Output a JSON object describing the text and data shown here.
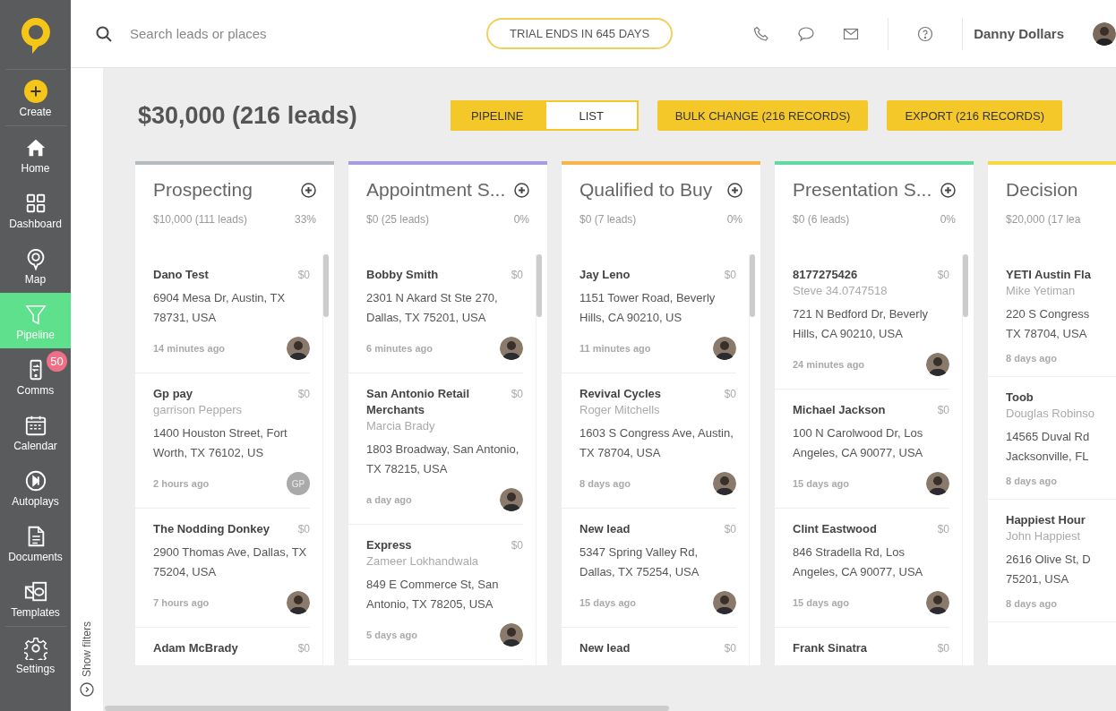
{
  "sidebar": {
    "items": [
      {
        "kind": "create",
        "label": "Create",
        "selected": false
      },
      {
        "kind": "home",
        "label": "Home",
        "selected": false
      },
      {
        "kind": "dashboard",
        "label": "Dashboard",
        "selected": false
      },
      {
        "kind": "map",
        "label": "Map",
        "selected": false
      },
      {
        "kind": "pipeline",
        "label": "Pipeline",
        "selected": true
      },
      {
        "kind": "comms",
        "label": "Comms",
        "selected": false,
        "badge": "50"
      },
      {
        "kind": "calendar",
        "label": "Calendar",
        "selected": false
      },
      {
        "kind": "autoplays",
        "label": "Autoplays",
        "selected": false
      },
      {
        "kind": "documents",
        "label": "Documents",
        "selected": false
      },
      {
        "kind": "templates",
        "label": "Templates",
        "selected": false
      },
      {
        "kind": "settings",
        "label": "Settings",
        "selected": false
      }
    ]
  },
  "search": {
    "placeholder": "Search leads or places"
  },
  "trial_banner": "TRIAL ENDS IN 645 DAYS",
  "user": {
    "name": "Danny Dollars"
  },
  "filters_toggle": "Show filters",
  "summary": "$30,000 (216 leads)",
  "view_toggle": [
    {
      "label": "PIPELINE",
      "selected": true
    },
    {
      "label": "LIST",
      "selected": false
    }
  ],
  "actions": [
    "BULK CHANGE (216 RECORDS)",
    "EXPORT (216 RECORDS)"
  ],
  "columns": [
    {
      "title": "Prospecting",
      "color": "#b4bcc0",
      "total": "$10,000 (111 leads)",
      "percent": "33%",
      "cards": [
        {
          "name": "Dano Test",
          "amount": "$0",
          "address": "6904 Mesa Dr, Austin, TX 78731, USA",
          "time": "14 minutes ago",
          "avatar": {
            "kind": "photo"
          }
        },
        {
          "name": "Gp pay",
          "amount": "$0",
          "contact": "garrison Peppers",
          "address": "1400 Houston Street, Fort Worth, TX 76102, US",
          "time": "2 hours ago",
          "avatar": {
            "kind": "initials",
            "text": "GP"
          }
        },
        {
          "name": "The Nodding Donkey",
          "amount": "$0",
          "address": "2900 Thomas Ave, Dallas, TX 75204, USA",
          "time": "7 hours ago",
          "avatar": {
            "kind": "photo"
          }
        },
        {
          "name": "Adam McBrady",
          "amount": "$0"
        }
      ]
    },
    {
      "title": "Appointment S...",
      "color": "#a99be0",
      "total": "$0 (25 leads)",
      "percent": "0%",
      "cards": [
        {
          "name": "Bobby Smith",
          "amount": "$0",
          "address": "2301 N Akard St Ste 270, Dallas, TX 75201, USA",
          "time": "6 minutes ago",
          "avatar": {
            "kind": "photo"
          }
        },
        {
          "name": "San Antonio Retail Merchants",
          "amount": "$0",
          "contact": "Marcia Brady",
          "address": "1803 Broadway, San Antonio, TX 78215, USA",
          "time": "a day ago",
          "avatar": {
            "kind": "photo"
          }
        },
        {
          "name": "Express",
          "amount": "$0",
          "contact": "Zameer Lokhandwala",
          "address": "849 E Commerce St, San Antonio, TX 78205, USA",
          "time": "5 days ago",
          "avatar": {
            "kind": "photo"
          }
        }
      ]
    },
    {
      "title": "Qualified to Buy",
      "color": "#f7b54a",
      "total": "$0 (7 leads)",
      "percent": "0%",
      "cards": [
        {
          "name": "Jay Leno",
          "amount": "$0",
          "address": "1151 Tower Road, Beverly Hills, CA 90210, US",
          "time": "11 minutes ago",
          "avatar": {
            "kind": "photo"
          }
        },
        {
          "name": "Revival Cycles",
          "amount": "$0",
          "contact": "Roger Mitchells",
          "address": "1603 S Congress Ave, Austin, TX 78704, USA",
          "time": "8 days ago",
          "avatar": {
            "kind": "photo"
          }
        },
        {
          "name": "New lead",
          "amount": "$0",
          "address": "5347 Spring Valley Rd, Dallas, TX 75254, USA",
          "time": "15 days ago",
          "avatar": {
            "kind": "photo"
          }
        },
        {
          "name": "New lead",
          "amount": "$0"
        }
      ]
    },
    {
      "title": "Presentation S...",
      "color": "#5fd9a5",
      "total": "$0 (6 leads)",
      "percent": "0%",
      "cards": [
        {
          "name": "8177275426",
          "amount": "$0",
          "contact": "Steve 34.0747518",
          "address": "721 N Bedford Dr, Beverly Hills, CA 90210, USA",
          "time": "24 minutes ago",
          "avatar": {
            "kind": "photo"
          }
        },
        {
          "name": "Michael Jackson",
          "amount": "$0",
          "address": "100 N Carolwood Dr, Los Angeles, CA 90077, USA",
          "time": "15 days ago",
          "avatar": {
            "kind": "photo"
          }
        },
        {
          "name": "Clint Eastwood",
          "amount": "$0",
          "address": "846 Stradella Rd, Los Angeles, CA 90077, USA",
          "time": "15 days ago",
          "avatar": {
            "kind": "photo"
          }
        },
        {
          "name": "Frank Sinatra",
          "amount": "$0"
        }
      ]
    },
    {
      "title": "Decision",
      "color": "#f5d93f",
      "total": "$20,000 (17 lea",
      "cards": [
        {
          "name": "YETI Austin Fla",
          "contact": "Mike Yetiman",
          "address_lines": [
            "220 S Congress",
            "TX 78704, USA"
          ],
          "time": "8 days ago"
        },
        {
          "name": "Toob",
          "contact": "Douglas Robinso",
          "address_lines": [
            "14565 Duval Rd",
            "Jacksonville, FL"
          ],
          "time": "8 days ago"
        },
        {
          "name": "Happiest Hour",
          "contact": "John Happiest",
          "address_lines": [
            "2616 Olive St, D",
            "75201, USA"
          ],
          "time": "8 days ago"
        }
      ]
    }
  ]
}
